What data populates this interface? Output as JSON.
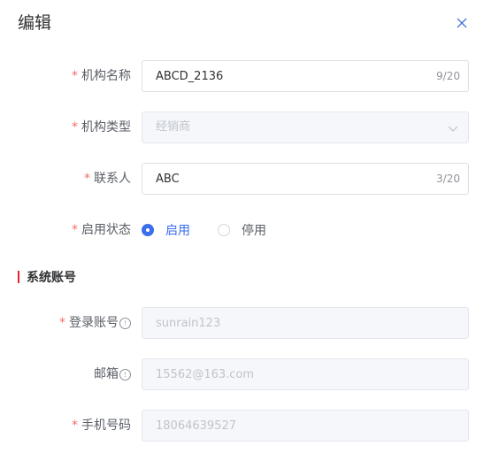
{
  "dialog": {
    "title": "编辑"
  },
  "form": {
    "org_name": {
      "label": "机构名称",
      "value": "ABCD_2136",
      "count": "9/20"
    },
    "org_type": {
      "label": "机构类型",
      "value": "经销商"
    },
    "contact": {
      "label": "联系人",
      "value": "ABC",
      "count": "3/20"
    },
    "status": {
      "label": "启用状态",
      "options": [
        "启用",
        "停用"
      ],
      "selected": "启用"
    }
  },
  "section": {
    "title": "系统账号"
  },
  "account": {
    "login": {
      "label": "登录账号",
      "value": "sunrain123"
    },
    "email": {
      "label": "邮箱",
      "value": "15562@163.com"
    },
    "phone": {
      "label": "手机号码",
      "value": "18064639527"
    }
  },
  "colors": {
    "accent": "#3b6eea",
    "required": "#f56c6c",
    "section_bar": "#e0262f"
  }
}
